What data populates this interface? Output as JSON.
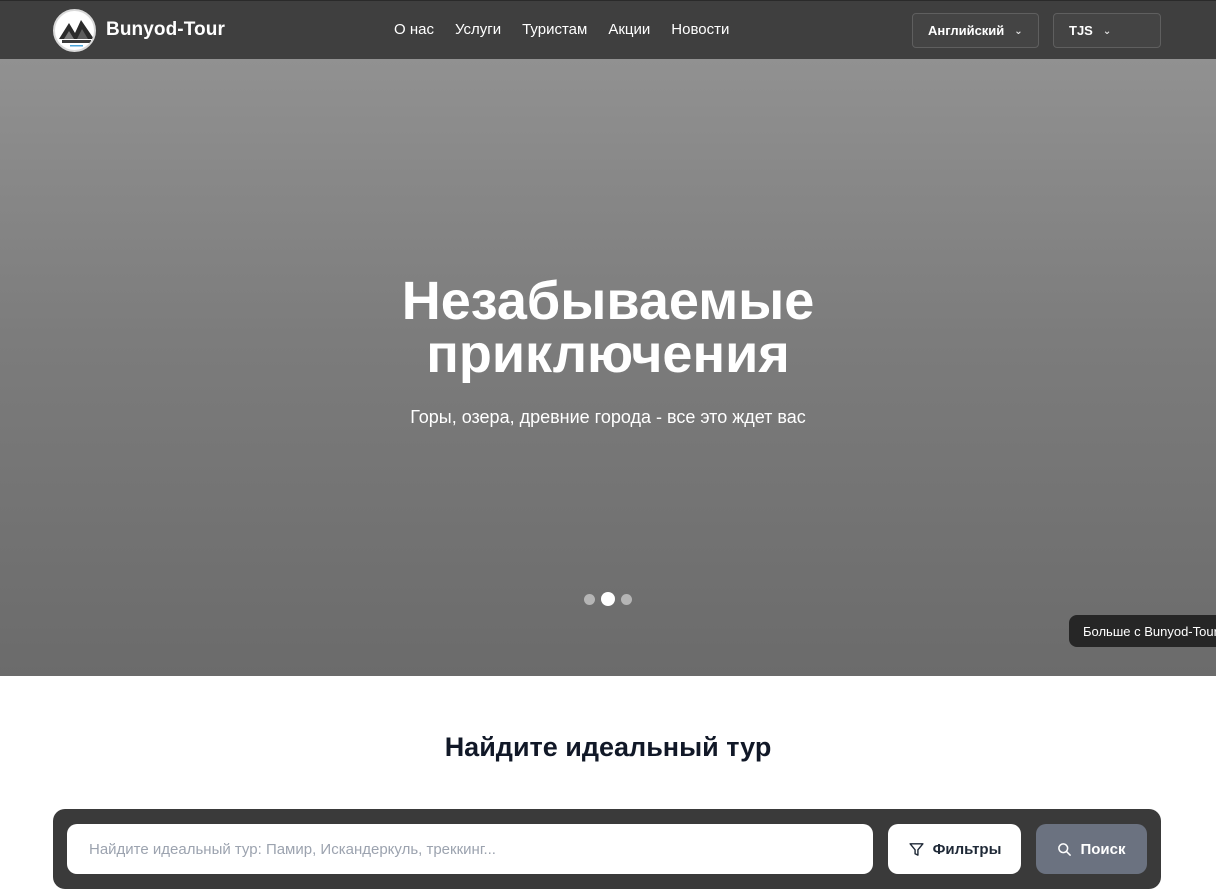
{
  "header": {
    "brand": "Bunyod-Tour",
    "logo_icon": "mountain-logo",
    "nav": [
      "О нас",
      "Услуги",
      "Туристам",
      "Акции",
      "Новости"
    ],
    "language": "Английский",
    "currency": "TJS"
  },
  "hero": {
    "title_line1": "Незабываемые",
    "title_line2": "приключения",
    "subtitle": "Горы, озера, древние города - все это ждет вас",
    "slides_total": 3,
    "active_slide": 2,
    "more_label": "Больше с Bunyod-Tour"
  },
  "search": {
    "title": "Найдите идеальный тур",
    "placeholder": "Найдите идеальный тур: Памир, Искандеркуль, треккинг...",
    "value": "",
    "filters_label": "Фильтры",
    "search_label": "Поиск",
    "filters_icon": "filter-icon",
    "search_icon": "search-icon"
  },
  "colors": {
    "header_bg": "#3f3f3f",
    "hero_bg_top": "#919191",
    "hero_bg_bottom": "#6b6b6b",
    "search_bar_bg": "#3a3a3a",
    "search_button_bg": "#6b7280"
  }
}
